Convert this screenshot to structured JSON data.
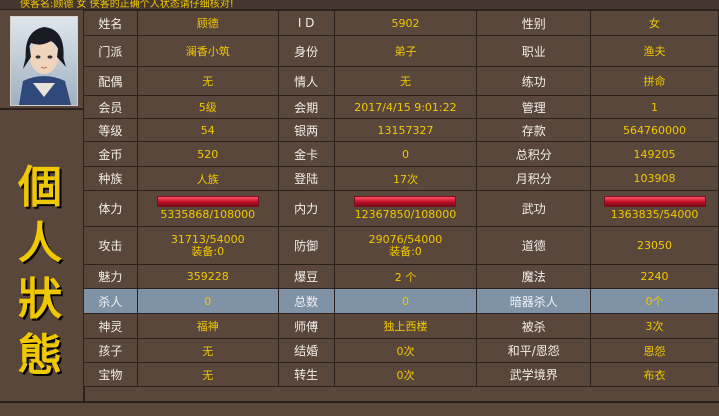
{
  "top_notice": "侠客名:顾德  女 侠客的正确个人状态请仔细核对!",
  "side_title": [
    "個",
    "人",
    "狀",
    "態"
  ],
  "colors": {
    "label": "#f2eee6",
    "value": "#f0c800",
    "highlight_row": "#7f92a6",
    "bg": "#5a473c",
    "red": "#ff2a2a",
    "blue": "#1a2cff"
  },
  "rows": [
    [
      {
        "label": "姓名",
        "value": "顾德"
      },
      {
        "label": "I D",
        "value": "5902"
      },
      {
        "label": "性别",
        "value": "女"
      }
    ],
    [
      {
        "label": "门派",
        "value": "澜香小筑"
      },
      {
        "label": "身份",
        "value": "弟子"
      },
      {
        "label": "职业",
        "value": "渔夫"
      }
    ],
    [
      {
        "label": "配偶",
        "value": "无"
      },
      {
        "label": "情人",
        "value": "无"
      },
      {
        "label": "练功",
        "value": "拼命"
      }
    ],
    [
      {
        "label": "会员",
        "value": "5级"
      },
      {
        "label": "会期",
        "value": "2017/4/15 9:01:22"
      },
      {
        "label": "管理",
        "value": "1"
      }
    ],
    [
      {
        "label": "等级",
        "value": "54"
      },
      {
        "label": "银两",
        "value": "13157327"
      },
      {
        "label": "存款",
        "value": "564760000"
      }
    ],
    [
      {
        "label": "金币",
        "value": "520"
      },
      {
        "label": "金卡",
        "value": "0"
      },
      {
        "label": "总积分",
        "value": "149205"
      }
    ],
    [
      {
        "label": "种族",
        "value": "人族"
      },
      {
        "label": "登陆",
        "value": "17次"
      },
      {
        "label": "月积分",
        "value": "103908"
      }
    ],
    [
      {
        "label": "体力",
        "value": "5335868/108000",
        "bar_fill": 1.0
      },
      {
        "label": "内力",
        "value": "12367850/108000",
        "bar_fill": 1.0
      },
      {
        "label": "武功",
        "value": "1363835/54000",
        "bar_fill": 1.0
      }
    ],
    [
      {
        "label": "攻击",
        "value": "31713/54000",
        "value2": "装备:0"
      },
      {
        "label": "防御",
        "value": "29076/54000",
        "value2": "装备:0"
      },
      {
        "label": "道德",
        "value": "23050"
      }
    ],
    [
      {
        "label": "魅力",
        "value": "359228"
      },
      {
        "label": "爆豆",
        "value": "2 个"
      },
      {
        "label": "魔法",
        "value": "2240"
      }
    ],
    [
      {
        "label": "杀人",
        "value": "0"
      },
      {
        "label": "总数",
        "value": "0"
      },
      {
        "label": "暗器杀人",
        "value": "0个"
      }
    ],
    [
      {
        "label": "神灵",
        "value": "福神"
      },
      {
        "label": "师傅",
        "value": "独上西楼"
      },
      {
        "label": "被杀",
        "value": "3次"
      }
    ],
    [
      {
        "label": "孩子",
        "value": "无"
      },
      {
        "label": "结婚",
        "value": "0次"
      },
      {
        "label": "和平/恩怨",
        "value": "恩怨"
      }
    ],
    [
      {
        "label": "宝物",
        "value": "无"
      },
      {
        "label": "转生",
        "value": "0次"
      },
      {
        "label": "武学境界",
        "value": "布衣"
      }
    ]
  ]
}
